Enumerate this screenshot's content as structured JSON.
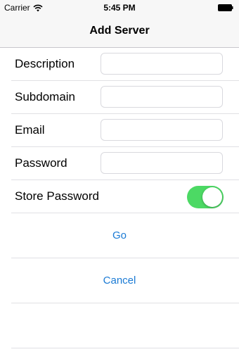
{
  "status_bar": {
    "carrier": "Carrier",
    "time": "5:45 PM",
    "wifi_icon": "wifi-icon",
    "battery_icon": "battery-icon"
  },
  "nav": {
    "title": "Add Server"
  },
  "form": {
    "description": {
      "label": "Description",
      "value": ""
    },
    "subdomain": {
      "label": "Subdomain",
      "value": ""
    },
    "email": {
      "label": "Email",
      "value": ""
    },
    "password": {
      "label": "Password",
      "value": ""
    },
    "store_password": {
      "label": "Store Password",
      "on": true
    }
  },
  "actions": {
    "go_label": "Go",
    "cancel_label": "Cancel"
  },
  "colors": {
    "accent": "#1a7ad4",
    "toggle_on": "#4cd964"
  }
}
